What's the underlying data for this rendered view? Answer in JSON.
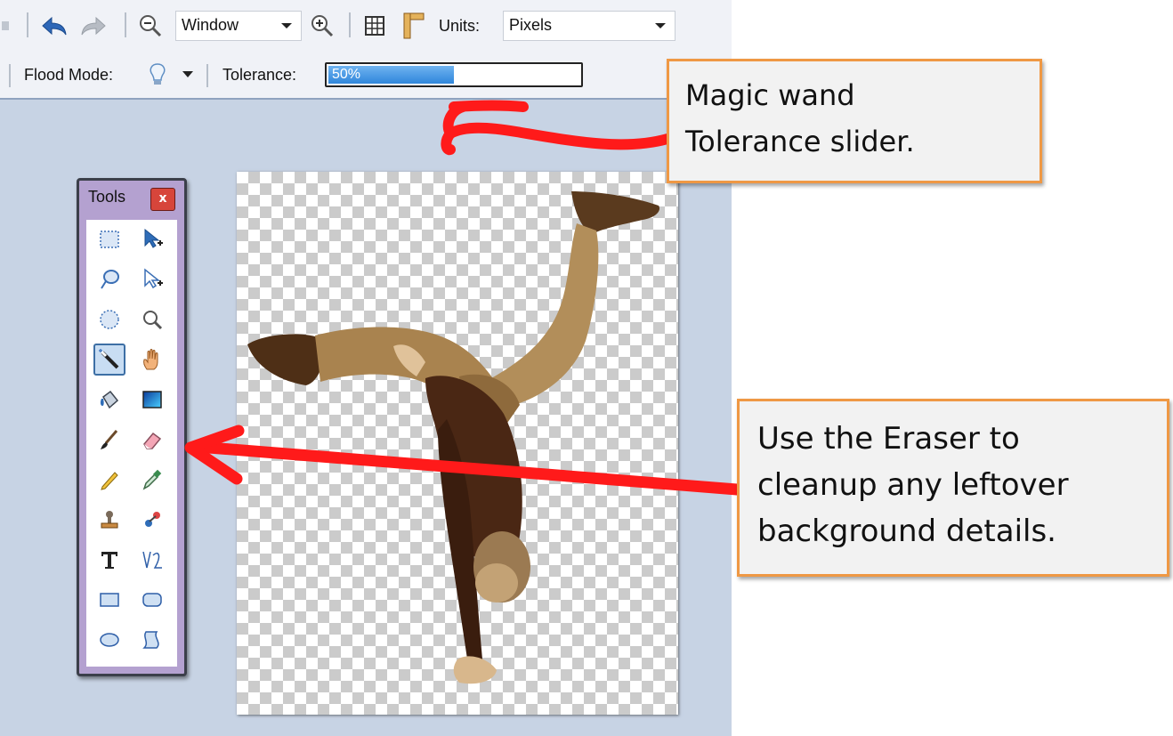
{
  "toolbar": {
    "zoom_mode": "Window",
    "units_label": "Units:",
    "units_value": "Pixels",
    "flood_mode_label": "Flood Mode:",
    "tolerance_label": "Tolerance:",
    "tolerance_value_text": "50%",
    "tolerance_value": 0.5
  },
  "tools_window": {
    "title": "Tools",
    "close_glyph": "x",
    "selected_tool": "magic-wand",
    "tools": [
      [
        "rectangle-select",
        "move-selected-pixels"
      ],
      [
        "lasso-select",
        "move-selection"
      ],
      [
        "ellipse-select",
        "zoom"
      ],
      [
        "magic-wand",
        "pan"
      ],
      [
        "paint-bucket",
        "gradient"
      ],
      [
        "paintbrush",
        "eraser"
      ],
      [
        "pencil",
        "color-picker"
      ],
      [
        "clone-stamp",
        "recolor"
      ],
      [
        "text",
        "line-curve"
      ],
      [
        "rectangle",
        "rounded-rectangle"
      ],
      [
        "ellipse",
        "freeform-shape"
      ]
    ]
  },
  "callouts": {
    "tolerance_note_line1": "Magic wand",
    "tolerance_note_line2": "Tolerance  slider.",
    "eraser_note_line1": "Use the Eraser to",
    "eraser_note_line2": "cleanup any leftover",
    "eraser_note_line3": "background details."
  },
  "colors": {
    "callout_border": "#ef9844",
    "arrow": "#ff1a1a",
    "workspace": "#c7d3e4",
    "tools_frame": "#b4a1d0"
  }
}
